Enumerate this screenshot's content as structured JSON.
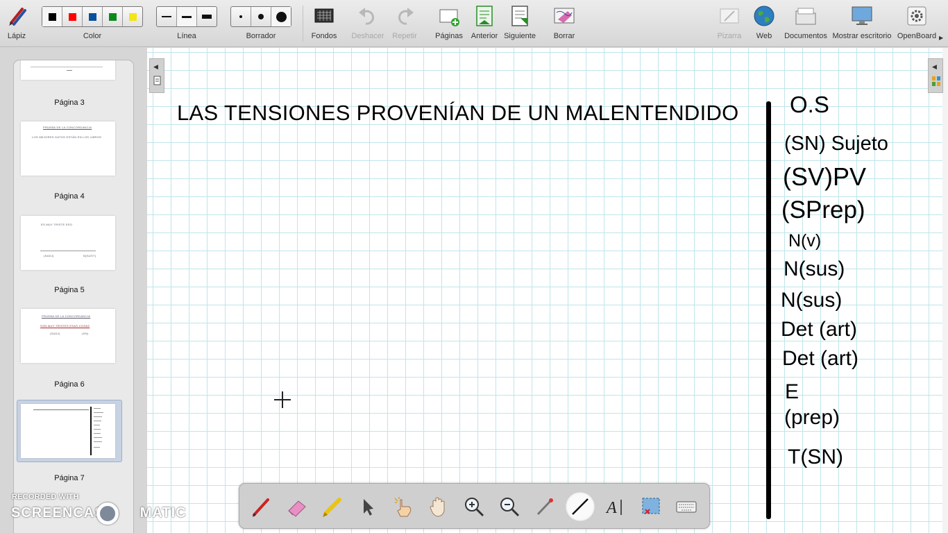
{
  "toolbar": {
    "pen": "Lápiz",
    "color": "Color",
    "line": "Línea",
    "eraser": "Borrador",
    "backgrounds": "Fondos",
    "undo": "Deshacer",
    "redo": "Repetir",
    "pages": "Páginas",
    "previous": "Anterior",
    "next": "Siguiente",
    "clear": "Borrar",
    "board": "Pizarra",
    "web": "Web",
    "documents": "Documentos",
    "show_desktop": "Mostrar escritorio",
    "app": "OpenBoard"
  },
  "colors": [
    "#000000",
    "#ff0000",
    "#0a4f9a",
    "#0c8a1a",
    "#f2e614"
  ],
  "pages_panel": {
    "labels": [
      "Página 3",
      "Página 4",
      "Página 5",
      "Página 6",
      "Página 7"
    ],
    "thumb4_title": "PRUEBA DE LA CONCORDANCIA",
    "thumb4_line": "LOS MEJORES DATOS ESTÁN EN LOS LIBROS",
    "thumb5_title": "ES MUY TRISTE ESO",
    "thumb5_left": "(SADJ)",
    "thumb5_right": "N(SUST)",
    "thumb6_title": "PRUEBA DE LA CONCORDANCIA",
    "thumb6_line": "SON MUY TRISTES ESAS COSAS",
    "thumb6_left": "(SADJ)",
    "thumb6_right": "(SN)"
  },
  "board": {
    "title": "LAS TENSIONES PROVENÍAN DE UN MALENTENDIDO",
    "annotations": {
      "os": "O.S",
      "sujeto": "(SN) Sujeto",
      "pv": "(SV)PV",
      "sprep": "(SPrep)",
      "nv": "N(v)",
      "nsus1": "N(sus)",
      "nsus2": "N(sus)",
      "det1": "Det (art)",
      "det2": "Det (art)",
      "e": "E",
      "prep": "(prep)",
      "tsn": "T(SN)"
    }
  },
  "watermark": {
    "line1": "RECORDED WITH",
    "line2a": "SCREENCAST",
    "line2b": "MATIC"
  }
}
